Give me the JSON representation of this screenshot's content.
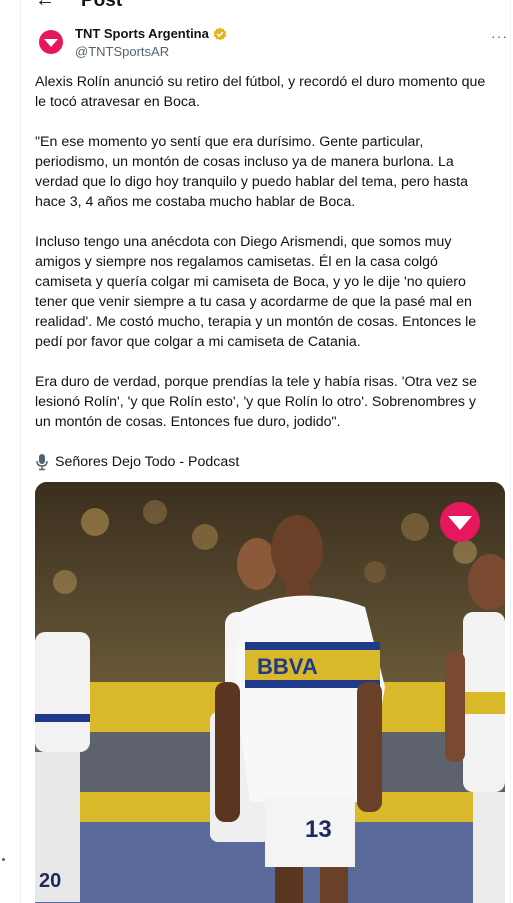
{
  "header": {
    "title": "Post",
    "back_icon": "arrow-left-icon"
  },
  "tweet": {
    "author_name": "TNT Sports Argentina",
    "author_handle": "@TNTSportsAR",
    "verified_color": "#e2b719",
    "more_label": "···",
    "paragraphs": [
      "Alexis Rolín anunció su retiro del fútbol, y recordó el duro momento que le tocó atravesar en Boca.",
      "\"En ese momento yo sentí que era durísimo. Gente particular, periodismo, un montón de cosas incluso ya de manera burlona. La verdad que lo digo hoy tranquilo y puedo hablar del tema, pero hasta hace 3, 4 años me costaba mucho hablar de Boca.",
      "Incluso tengo una anécdota con Diego Arismendi, que somos muy amigos y siempre nos regalamos camisetas. Él en la casa colgó camiseta y quería colgar mi camiseta de Boca, y yo le dije 'no quiero tener que venir siempre a tu casa y acordarme de que la pasé mal en realidad'. Me costó mucho, terapia y un montón de cosas. Entonces le pedí por favor que colgar a mi camiseta de Catania.",
      "Era duro de verdad, porque prendías la tele y había risas. 'Otra vez se lesionó Rolín', 'y que Rolín esto', 'y que Rolín lo otro'. Sobrenombres y un montón de cosas. Entonces fue duro, jodido\"."
    ],
    "source_label": "Señores Dejo Todo - Podcast",
    "source_icon": "microphone-icon"
  },
  "media": {
    "shirt_sponsor": "BBVA",
    "number_center": "13",
    "number_left": "20",
    "brand_color": "#e6175c"
  }
}
